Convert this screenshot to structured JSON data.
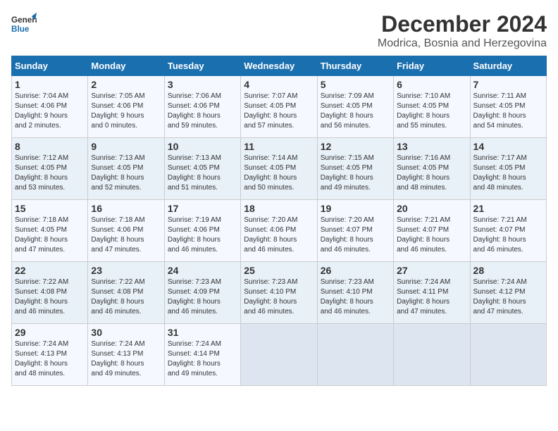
{
  "header": {
    "logo_line1": "General",
    "logo_line2": "Blue",
    "month_title": "December 2024",
    "location": "Modrica, Bosnia and Herzegovina"
  },
  "calendar": {
    "days_of_week": [
      "Sunday",
      "Monday",
      "Tuesday",
      "Wednesday",
      "Thursday",
      "Friday",
      "Saturday"
    ],
    "weeks": [
      [
        {
          "day": "1",
          "info": "Sunrise: 7:04 AM\nSunset: 4:06 PM\nDaylight: 9 hours\nand 2 minutes."
        },
        {
          "day": "2",
          "info": "Sunrise: 7:05 AM\nSunset: 4:06 PM\nDaylight: 9 hours\nand 0 minutes."
        },
        {
          "day": "3",
          "info": "Sunrise: 7:06 AM\nSunset: 4:06 PM\nDaylight: 8 hours\nand 59 minutes."
        },
        {
          "day": "4",
          "info": "Sunrise: 7:07 AM\nSunset: 4:05 PM\nDaylight: 8 hours\nand 57 minutes."
        },
        {
          "day": "5",
          "info": "Sunrise: 7:09 AM\nSunset: 4:05 PM\nDaylight: 8 hours\nand 56 minutes."
        },
        {
          "day": "6",
          "info": "Sunrise: 7:10 AM\nSunset: 4:05 PM\nDaylight: 8 hours\nand 55 minutes."
        },
        {
          "day": "7",
          "info": "Sunrise: 7:11 AM\nSunset: 4:05 PM\nDaylight: 8 hours\nand 54 minutes."
        }
      ],
      [
        {
          "day": "8",
          "info": "Sunrise: 7:12 AM\nSunset: 4:05 PM\nDaylight: 8 hours\nand 53 minutes."
        },
        {
          "day": "9",
          "info": "Sunrise: 7:13 AM\nSunset: 4:05 PM\nDaylight: 8 hours\nand 52 minutes."
        },
        {
          "day": "10",
          "info": "Sunrise: 7:13 AM\nSunset: 4:05 PM\nDaylight: 8 hours\nand 51 minutes."
        },
        {
          "day": "11",
          "info": "Sunrise: 7:14 AM\nSunset: 4:05 PM\nDaylight: 8 hours\nand 50 minutes."
        },
        {
          "day": "12",
          "info": "Sunrise: 7:15 AM\nSunset: 4:05 PM\nDaylight: 8 hours\nand 49 minutes."
        },
        {
          "day": "13",
          "info": "Sunrise: 7:16 AM\nSunset: 4:05 PM\nDaylight: 8 hours\nand 48 minutes."
        },
        {
          "day": "14",
          "info": "Sunrise: 7:17 AM\nSunset: 4:05 PM\nDaylight: 8 hours\nand 48 minutes."
        }
      ],
      [
        {
          "day": "15",
          "info": "Sunrise: 7:18 AM\nSunset: 4:05 PM\nDaylight: 8 hours\nand 47 minutes."
        },
        {
          "day": "16",
          "info": "Sunrise: 7:18 AM\nSunset: 4:06 PM\nDaylight: 8 hours\nand 47 minutes."
        },
        {
          "day": "17",
          "info": "Sunrise: 7:19 AM\nSunset: 4:06 PM\nDaylight: 8 hours\nand 46 minutes."
        },
        {
          "day": "18",
          "info": "Sunrise: 7:20 AM\nSunset: 4:06 PM\nDaylight: 8 hours\nand 46 minutes."
        },
        {
          "day": "19",
          "info": "Sunrise: 7:20 AM\nSunset: 4:07 PM\nDaylight: 8 hours\nand 46 minutes."
        },
        {
          "day": "20",
          "info": "Sunrise: 7:21 AM\nSunset: 4:07 PM\nDaylight: 8 hours\nand 46 minutes."
        },
        {
          "day": "21",
          "info": "Sunrise: 7:21 AM\nSunset: 4:07 PM\nDaylight: 8 hours\nand 46 minutes."
        }
      ],
      [
        {
          "day": "22",
          "info": "Sunrise: 7:22 AM\nSunset: 4:08 PM\nDaylight: 8 hours\nand 46 minutes."
        },
        {
          "day": "23",
          "info": "Sunrise: 7:22 AM\nSunset: 4:08 PM\nDaylight: 8 hours\nand 46 minutes."
        },
        {
          "day": "24",
          "info": "Sunrise: 7:23 AM\nSunset: 4:09 PM\nDaylight: 8 hours\nand 46 minutes."
        },
        {
          "day": "25",
          "info": "Sunrise: 7:23 AM\nSunset: 4:10 PM\nDaylight: 8 hours\nand 46 minutes."
        },
        {
          "day": "26",
          "info": "Sunrise: 7:23 AM\nSunset: 4:10 PM\nDaylight: 8 hours\nand 46 minutes."
        },
        {
          "day": "27",
          "info": "Sunrise: 7:24 AM\nSunset: 4:11 PM\nDaylight: 8 hours\nand 47 minutes."
        },
        {
          "day": "28",
          "info": "Sunrise: 7:24 AM\nSunset: 4:12 PM\nDaylight: 8 hours\nand 47 minutes."
        }
      ],
      [
        {
          "day": "29",
          "info": "Sunrise: 7:24 AM\nSunset: 4:13 PM\nDaylight: 8 hours\nand 48 minutes."
        },
        {
          "day": "30",
          "info": "Sunrise: 7:24 AM\nSunset: 4:13 PM\nDaylight: 8 hours\nand 49 minutes."
        },
        {
          "day": "31",
          "info": "Sunrise: 7:24 AM\nSunset: 4:14 PM\nDaylight: 8 hours\nand 49 minutes."
        },
        {
          "day": "",
          "info": ""
        },
        {
          "day": "",
          "info": ""
        },
        {
          "day": "",
          "info": ""
        },
        {
          "day": "",
          "info": ""
        }
      ]
    ]
  }
}
